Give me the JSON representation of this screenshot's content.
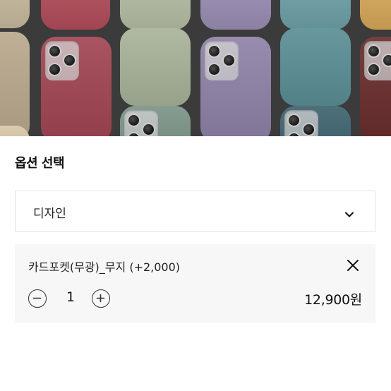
{
  "product_image": {
    "alt_icon": "phone-case-photo",
    "case_colors": [
      "#b9a98d",
      "#a24653",
      "#a9b39a",
      "#8f82a8",
      "#5b8f96",
      "#6a2d2e",
      "#c99a4f"
    ]
  },
  "option_section": {
    "title": "옵션 선택",
    "select": {
      "label": "디자인",
      "icon": "chevron-down-icon"
    }
  },
  "selected_option": {
    "name": "카드포켓(무광)_무지 (+2,000)",
    "quantity": "1",
    "price": "12,900원",
    "remove_icon": "close-icon",
    "decrease_icon": "minus-circle-icon",
    "increase_icon": "plus-circle-icon"
  },
  "colors": {
    "card_background": "#f7f7f7",
    "border": "#e2e2e2",
    "text": "#111111"
  }
}
